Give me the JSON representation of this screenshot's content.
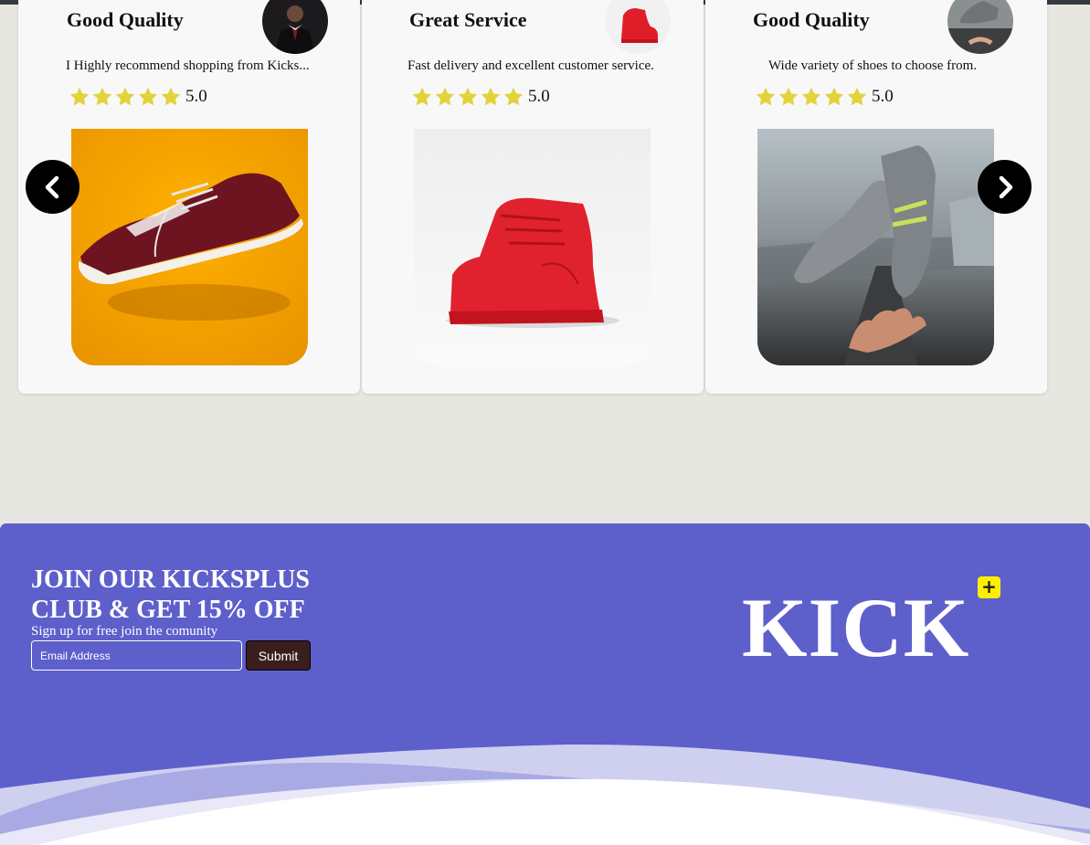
{
  "testimonials": [
    {
      "title": "Good Quality",
      "text": "I Highly recommend shopping from Kicks...",
      "rating": 5,
      "rating_label": "5.0",
      "avatar_icon": "person-in-suit-avatar",
      "photo_icon": "burgundy-skate-shoe-photo"
    },
    {
      "title": "Great Service",
      "text": "Fast delivery and excellent customer service.",
      "rating": 5,
      "rating_label": "5.0",
      "avatar_icon": "red-sneaker-avatar",
      "photo_icon": "red-high-top-sneaker-photo"
    },
    {
      "title": "Good Quality",
      "text": "Wide variety of shoes to choose from.",
      "rating": 5,
      "rating_label": "5.0",
      "avatar_icon": "grey-sneaker-avatar",
      "photo_icon": "grey-knit-sneakers-photo"
    }
  ],
  "carousel": {
    "prev_icon": "chevron-left-icon",
    "next_icon": "chevron-right-icon"
  },
  "newsletter": {
    "heading": "JOIN OUR KICKSPLUS CLUB & GET 15% OFF",
    "subtext": "Sign up for free join the comunity",
    "email_placeholder": "Email Address",
    "submit_label": "Submit"
  },
  "logo": {
    "text": "KICK",
    "badge": "+"
  },
  "colors": {
    "footer_bg": "#5d5fcb",
    "star": "#e2d33a",
    "logo_badge": "#ffee00",
    "submit_bg": "#3a1e1e",
    "page_bg": "#e7e7e2",
    "card_bg": "#f8f8f8"
  }
}
